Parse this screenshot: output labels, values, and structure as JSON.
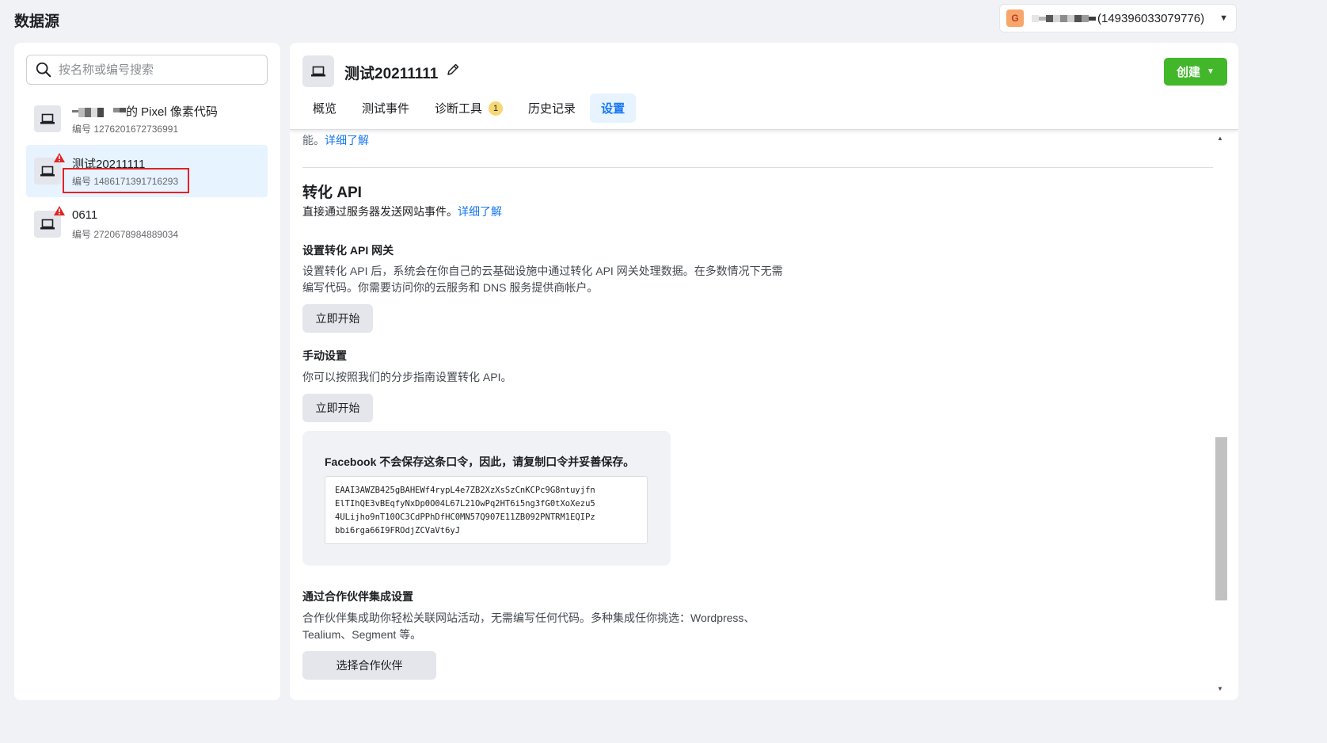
{
  "page": {
    "title": "数据源"
  },
  "account": {
    "avatar_letter": "G",
    "name": "(149396033079776)"
  },
  "search": {
    "placeholder": "按名称或编号搜索"
  },
  "data_sources": [
    {
      "name": "的 Pixel 像素代码",
      "id_text": "编号 1276201672736991",
      "warning": false,
      "selected": false
    },
    {
      "name": "测试20211111",
      "id_text": "编号 1486171391716293",
      "warning": true,
      "selected": true
    },
    {
      "name": "0611",
      "id_text": "编号 2720678984889034",
      "warning": true,
      "selected": false
    }
  ],
  "header": {
    "title": "测试20211111",
    "create_label": "创建",
    "tabs": [
      {
        "label": "概览"
      },
      {
        "label": "测试事件"
      },
      {
        "label": "诊断工具",
        "badge": "1"
      },
      {
        "label": "历史记录"
      },
      {
        "label": "设置",
        "active": true
      }
    ]
  },
  "content": {
    "top_text": "能。",
    "top_link": "详细了解",
    "section_title": "转化 API",
    "section_desc": "直接通过服务器发送网站事件。",
    "section_link": "详细了解",
    "gateway_title": "设置转化 API 网关",
    "gateway_desc": "设置转化 API 后，系统会在你自己的云基础设施中通过转化 API 网关处理数据。在多数情况下无需编写代码。你需要访问你的云服务和 DNS 服务提供商帐户。",
    "gateway_button": "立即开始",
    "manual_title": "手动设置",
    "manual_desc": "你可以按照我们的分步指南设置转化 API。",
    "manual_button": "立即开始",
    "token_title": "Facebook 不会保存这条口令，因此，请复制口令并妥善保存。",
    "token_value": "EAAI3AWZB425gBAHEWf4rypL4e7ZB2XzXsSzCnKCPc9G8ntuyjfn\nElTIhQE3vBEqfyNxDp0O04L67L21OwPq2HT6i5ng3fG0tXoXezu5\n4ULijho9nT10OC3CdPPhDfHC0MN57Q907E11ZB092PNTRM1EQIPz\nbbi6rga66I9FROdjZCVaVt6yJ",
    "partner_title": "通过合作伙伴集成设置",
    "partner_desc": "合作伙伴集成助你轻松关联网站活动，无需编写任何代码。多种集成任你挑选：Wordpress、Tealium、Segment 等。",
    "partner_button": "选择合作伙伴"
  },
  "colors": {
    "accent": "#1877f2",
    "create": "#42b72a",
    "warning": "#e02424",
    "selected_bg": "#e7f3ff"
  }
}
